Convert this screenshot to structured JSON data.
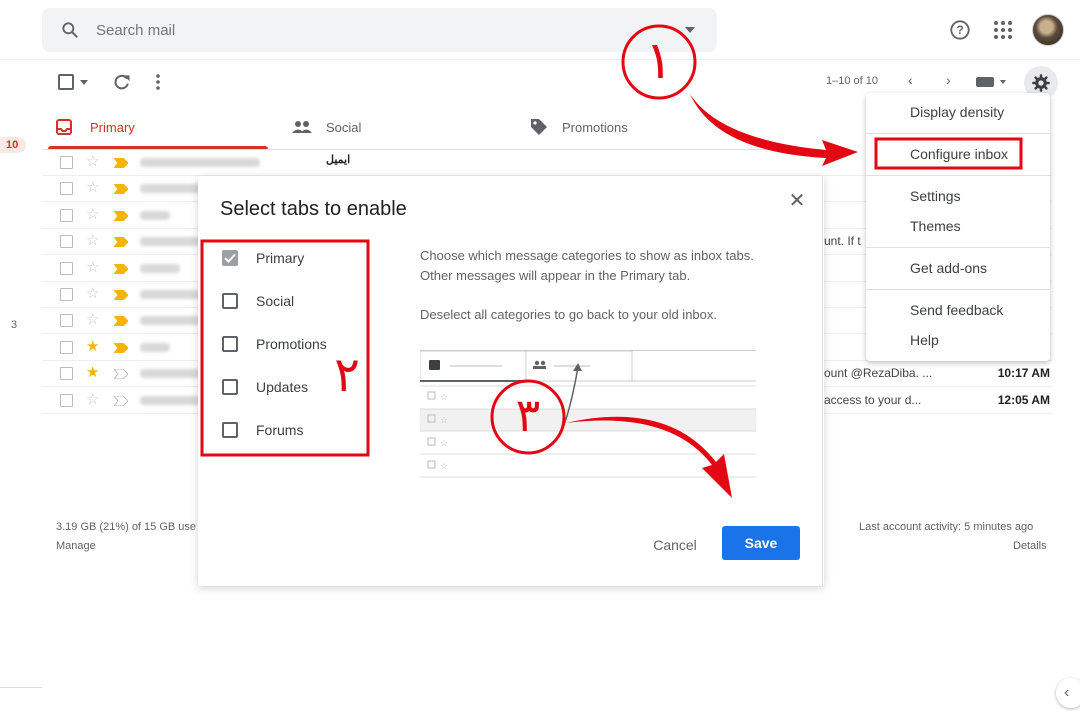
{
  "search": {
    "placeholder": "Search mail"
  },
  "toolbar": {
    "pagination": "1–10 of 10"
  },
  "tabs": [
    {
      "label": "Primary"
    },
    {
      "label": "Social"
    },
    {
      "label": "Promotions"
    }
  ],
  "left_counts": {
    "inbox": "10",
    "other": "3"
  },
  "rows": [
    {
      "starred": false,
      "tail": "",
      "time": ""
    },
    {
      "starred": false,
      "tail": "",
      "time": ""
    },
    {
      "starred": false,
      "tail": "",
      "time": ""
    },
    {
      "starred": false,
      "tail": "unt. If t",
      "time": ""
    },
    {
      "starred": false,
      "tail": "",
      "time": ""
    },
    {
      "starred": false,
      "tail": "",
      "time": ""
    },
    {
      "starred": false,
      "tail": "",
      "time": ""
    },
    {
      "starred": true,
      "tail": "",
      "time": ""
    },
    {
      "starred": true,
      "tail": "ount @RezaDiba. ...",
      "time": "10:17 AM"
    },
    {
      "starred": false,
      "tail": "access to your d...",
      "time": "12:05 AM"
    }
  ],
  "row_partial_text": "ایمیل",
  "dialog": {
    "title": "Select tabs to enable",
    "options": [
      {
        "label": "Primary",
        "checked": true
      },
      {
        "label": "Social",
        "checked": false
      },
      {
        "label": "Promotions",
        "checked": false
      },
      {
        "label": "Updates",
        "checked": false
      },
      {
        "label": "Forums",
        "checked": false
      }
    ],
    "desc1": "Choose which message categories to show as inbox tabs. Other messages will appear in the Primary tab.",
    "desc2": "Deselect all categories to go back to your old inbox.",
    "cancel": "Cancel",
    "save": "Save"
  },
  "menu": {
    "items": [
      "Display density",
      "Configure inbox",
      "Settings",
      "Themes",
      "Get add-ons",
      "Send feedback",
      "Help"
    ]
  },
  "footer": {
    "storage": "3.19 GB (21%) of 15 GB use",
    "manage": "Manage",
    "activity": "Last account activity: 5 minutes ago",
    "details": "Details"
  },
  "annotations": {
    "one": "١",
    "two": "٢",
    "three": "٣"
  },
  "colors": {
    "accent_red": "#d93025",
    "save_blue": "#1a73e8",
    "annotation_red": "#e30613",
    "star_yellow": "#f4b400"
  }
}
